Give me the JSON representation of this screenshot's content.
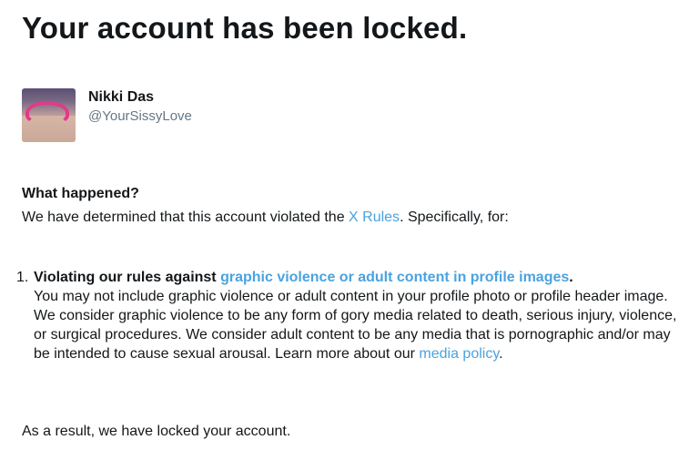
{
  "page": {
    "title": "Your account has been locked."
  },
  "account": {
    "display_name": "Nikki Das",
    "handle": "@YourSissyLove"
  },
  "notice": {
    "heading": "What happened?",
    "intro_before": "We have determined that this account violated the ",
    "intro_link": "X Rules",
    "intro_after": ". Specifically, for:"
  },
  "violations": [
    {
      "number": "1.",
      "title_prefix": "Violating our rules against ",
      "title_link": "graphic violence or adult content in profile images",
      "title_suffix": ".",
      "description": "You may not include graphic violence or adult content in your profile photo or profile header image. We consider graphic violence to be any form of gory media related to death, serious injury, violence, or surgical procedures. We consider adult content to be any media that is pornographic and/or may be intended to cause sexual arousal. Learn more about our ",
      "description_link": "media policy",
      "description_suffix": "."
    }
  ],
  "result": "As a result, we have locked your account.",
  "colors": {
    "text": "#14171a",
    "muted": "#657786",
    "link": "#4aa3df"
  }
}
